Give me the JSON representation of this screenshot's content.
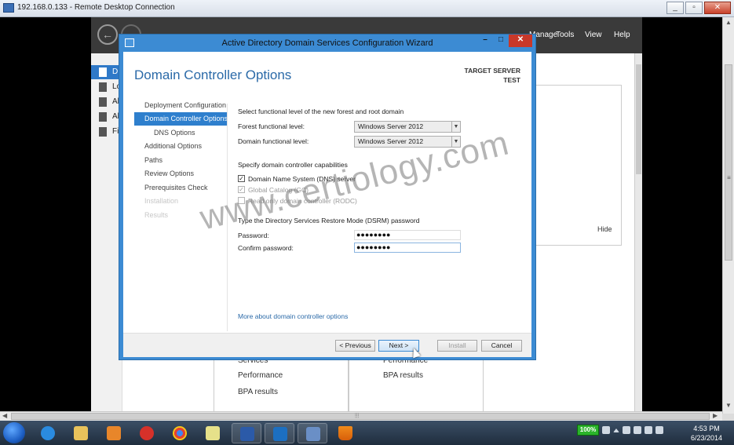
{
  "rdp": {
    "title": "192.168.0.133 - Remote Desktop Connection",
    "minimize": "_",
    "restore": "▫",
    "close": "✕"
  },
  "server_manager": {
    "menu": [
      "Manage",
      "Tools",
      "View",
      "Help"
    ],
    "nav_labels": [
      "D",
      "Lo",
      "Al",
      "Al",
      "Fi"
    ],
    "hide_label": "Hide",
    "tile_left": [
      "Services",
      "Performance",
      "BPA results"
    ],
    "tile_right": [
      "Performance",
      "BPA results"
    ]
  },
  "wizard": {
    "title": "Active Directory Domain Services Configuration Wizard",
    "heading": "Domain Controller Options",
    "target_label": "TARGET SERVER",
    "target_value": "TEST",
    "nav": [
      {
        "label": "Deployment Configuration",
        "state": "normal"
      },
      {
        "label": "Domain Controller Options",
        "state": "active"
      },
      {
        "label": "DNS Options",
        "state": "sub"
      },
      {
        "label": "Additional Options",
        "state": "normal"
      },
      {
        "label": "Paths",
        "state": "normal"
      },
      {
        "label": "Review Options",
        "state": "normal"
      },
      {
        "label": "Prerequisites Check",
        "state": "normal"
      },
      {
        "label": "Installation",
        "state": "disabled"
      },
      {
        "label": "Results",
        "state": "disabled"
      }
    ],
    "section_functional": "Select functional level of the new forest and root domain",
    "forest_label": "Forest functional level:",
    "forest_value": "Windows Server 2012",
    "domain_label": "Domain functional level:",
    "domain_value": "Windows Server 2012",
    "section_capabilities": "Specify domain controller capabilities",
    "cap_dns": "Domain Name System (DNS) server",
    "cap_gc": "Global Catalog (GC)",
    "cap_rodc": "Read only domain controller (RODC)",
    "section_dsrm": "Type the Directory Services Restore Mode (DSRM) password",
    "password_label": "Password:",
    "password_value": "●●●●●●●●",
    "confirm_label": "Confirm password:",
    "confirm_value": "●●●●●●●●",
    "more_link": "More about domain controller options",
    "btn_previous": "< Previous",
    "btn_next": "Next >",
    "btn_install": "Install",
    "btn_cancel": "Cancel"
  },
  "watermark": "www.certiology.com",
  "taskbar": {
    "battery": "100%",
    "time": "4:53 PM",
    "date": "6/23/2014"
  }
}
